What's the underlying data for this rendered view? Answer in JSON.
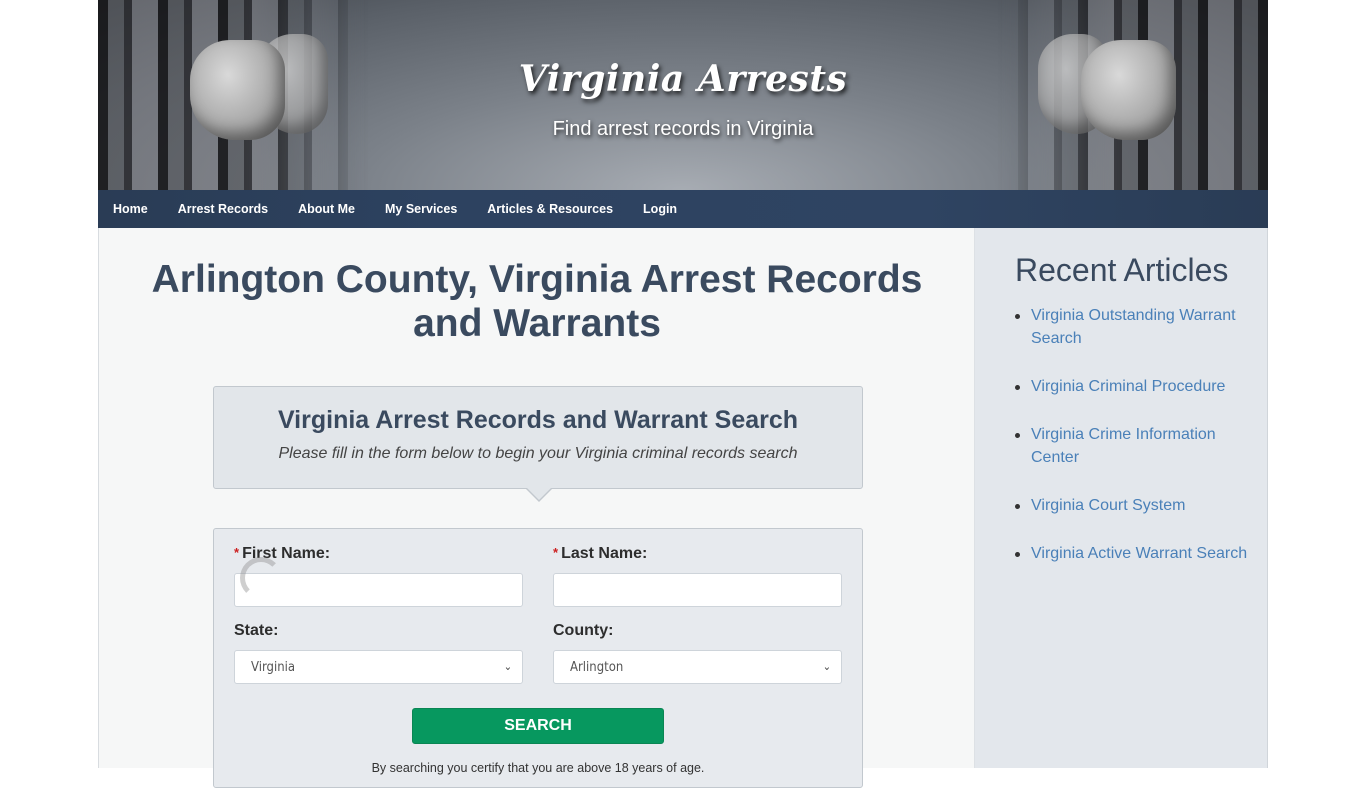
{
  "header": {
    "site_title": "Virginia Arrests",
    "tagline": "Find arrest records in Virginia"
  },
  "nav": {
    "items": [
      {
        "label": "Home"
      },
      {
        "label": "Arrest Records"
      },
      {
        "label": "About Me"
      },
      {
        "label": "My Services"
      },
      {
        "label": "Articles & Resources"
      },
      {
        "label": "Login"
      }
    ]
  },
  "main": {
    "page_title": "Arlington County, Virginia Arrest Records and Warrants",
    "intro": {
      "title": "Virginia Arrest Records and Warrant Search",
      "subtitle": "Please fill in the form below to begin your Virginia criminal records search"
    },
    "form": {
      "required_marker": "*",
      "first_name": {
        "label": "First Name:",
        "value": "",
        "placeholder": ""
      },
      "last_name": {
        "label": "Last Name:",
        "value": "",
        "placeholder": ""
      },
      "state": {
        "label": "State:",
        "selected": "Virginia"
      },
      "county": {
        "label": "County:",
        "selected": "Arlington"
      },
      "search_button": "SEARCH",
      "disclaimer": "By searching you certify that you are above 18 years of age."
    }
  },
  "sidebar": {
    "title": "Recent Articles",
    "articles": [
      {
        "label": "Virginia Outstanding Warrant Search"
      },
      {
        "label": "Virginia Criminal Procedure"
      },
      {
        "label": "Virginia Crime Information Center"
      },
      {
        "label": "Virginia Court System"
      },
      {
        "label": "Virginia Active Warrant Search"
      }
    ]
  },
  "colors": {
    "nav_bg": "#2d4260",
    "heading": "#3a4a5f",
    "link": "#4a80b8",
    "search_button": "#07985f",
    "required": "#cc1f1f"
  }
}
